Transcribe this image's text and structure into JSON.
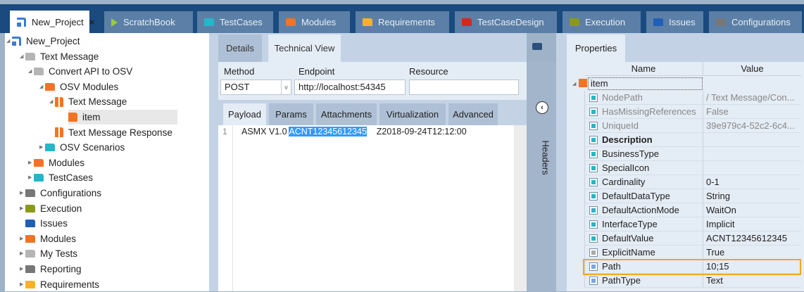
{
  "tabs": [
    {
      "label": "New_Project",
      "icon": "project-icon",
      "color": "#3a7bd5",
      "active": true,
      "closable": true
    },
    {
      "label": "ScratchBook",
      "icon": "play-icon",
      "color": "#9acd32"
    },
    {
      "label": "TestCases",
      "icon": "folder-icon",
      "color": "#22b8c8"
    },
    {
      "label": "Modules",
      "icon": "folder-icon",
      "color": "#f47321"
    },
    {
      "label": "Requirements",
      "icon": "folder-icon",
      "color": "#fbb02d"
    },
    {
      "label": "TestCaseDesign",
      "icon": "folder-icon",
      "color": "#d9261c"
    },
    {
      "label": "Execution",
      "icon": "folder-icon",
      "color": "#8a9a17"
    },
    {
      "label": "Issues",
      "icon": "folder-icon",
      "color": "#1f5fb8"
    },
    {
      "label": "Configurations",
      "icon": "configurations-icon",
      "color": "#777777"
    }
  ],
  "close_glyph": "×",
  "tree": [
    {
      "label": "New_Project",
      "level": 0,
      "icon": "project-icon",
      "color": "#3a7bd5",
      "expanded": true
    },
    {
      "label": "Text Message",
      "level": 1,
      "icon": "folder-icon",
      "color": "#b5b5b5",
      "expanded": true
    },
    {
      "label": "Convert API to OSV",
      "level": 2,
      "icon": "folder-icon",
      "color": "#b5b5b5",
      "expanded": true
    },
    {
      "label": "OSV Modules",
      "level": 3,
      "icon": "folder-icon",
      "color": "#f47321",
      "expanded": true
    },
    {
      "label": "Text Message",
      "level": 4,
      "icon": "module-icon",
      "color": "#f47321",
      "expanded": true
    },
    {
      "label": "item",
      "level": 5,
      "icon": "module-attribute-icon",
      "color": "#f47321",
      "selected": true
    },
    {
      "label": "Text Message Response",
      "level": 4,
      "icon": "module-icon",
      "color": "#f47321"
    },
    {
      "label": "OSV Scenarios",
      "level": 3,
      "icon": "folder-icon",
      "color": "#22b8c8",
      "collapsed": true
    },
    {
      "label": "Modules",
      "level": 2,
      "icon": "folder-icon",
      "color": "#f47321",
      "collapsed": true
    },
    {
      "label": "TestCases",
      "level": 2,
      "icon": "folder-icon",
      "color": "#22b8c8",
      "collapsed": true
    },
    {
      "label": "Configurations",
      "level": 1,
      "icon": "configurations-icon",
      "color": "#777777",
      "collapsed": true
    },
    {
      "label": "Execution",
      "level": 1,
      "icon": "folder-icon",
      "color": "#8a9a17",
      "collapsed": true
    },
    {
      "label": "Issues",
      "level": 1,
      "icon": "folder-icon",
      "color": "#1f5fb8"
    },
    {
      "label": "Modules",
      "level": 1,
      "icon": "folder-icon",
      "color": "#f47321",
      "collapsed": true
    },
    {
      "label": "My Tests",
      "level": 1,
      "icon": "folder-icon",
      "color": "#b5b5b5",
      "collapsed": true
    },
    {
      "label": "Reporting",
      "level": 1,
      "icon": "reporting-icon",
      "color": "#777777",
      "collapsed": true
    },
    {
      "label": "Requirements",
      "level": 1,
      "icon": "folder-icon",
      "color": "#fbb02d",
      "collapsed": true
    }
  ],
  "middle": {
    "tabs": [
      "Details",
      "Technical View"
    ],
    "method_label": "Method",
    "method_value": "POST",
    "endpoint_label": "Endpoint",
    "endpoint_value": "http://localhost:54345",
    "resource_label": "Resource",
    "resource_value": "",
    "payload_tabs": [
      "Payload",
      "Params",
      "Attachments",
      "Virtualization",
      "Advanced"
    ],
    "line_number": "1",
    "payload_before": "ASMX V1.0 ",
    "payload_selected": "ACNT12345612345",
    "payload_after": "    Z2018-09-24T12:12:00",
    "headers_label": "Headers"
  },
  "properties": {
    "tab": "Properties",
    "col_name": "Name",
    "col_value": "Value",
    "root": "item",
    "rows": [
      {
        "name": "NodePath",
        "value": "/ Text Message/Con...",
        "readonly": true,
        "color": "#22b8c8"
      },
      {
        "name": "HasMissingReferences",
        "value": "False",
        "readonly": true,
        "color": "#22b8c8"
      },
      {
        "name": "UniqueId",
        "value": "39e979c4-52c2-6c4...",
        "readonly": true,
        "color": "#22b8c8"
      },
      {
        "name": "Description",
        "value": "",
        "bold": true,
        "color": "#22b8c8"
      },
      {
        "name": "BusinessType",
        "value": "",
        "color": "#22b8c8"
      },
      {
        "name": "SpecialIcon",
        "value": "",
        "color": "#22b8c8"
      },
      {
        "name": "Cardinality",
        "value": "0-1",
        "color": "#22b8c8"
      },
      {
        "name": "DefaultDataType",
        "value": "String",
        "color": "#22b8c8"
      },
      {
        "name": "DefaultActionMode",
        "value": "WaitOn",
        "color": "#22b8c8"
      },
      {
        "name": "InterfaceType",
        "value": "Implicit",
        "color": "#22b8c8"
      },
      {
        "name": "DefaultValue",
        "value": "ACNT12345612345",
        "color": "#22b8c8"
      },
      {
        "name": "ExplicitName",
        "value": "True",
        "color": "#aaaaaa"
      },
      {
        "name": "Path",
        "value": "10;15",
        "color": "#7aa7e0",
        "highlighted": true
      },
      {
        "name": "PathType",
        "value": "Text",
        "color": "#7aa7e0"
      }
    ]
  },
  "highlight_color": "#f5a623"
}
